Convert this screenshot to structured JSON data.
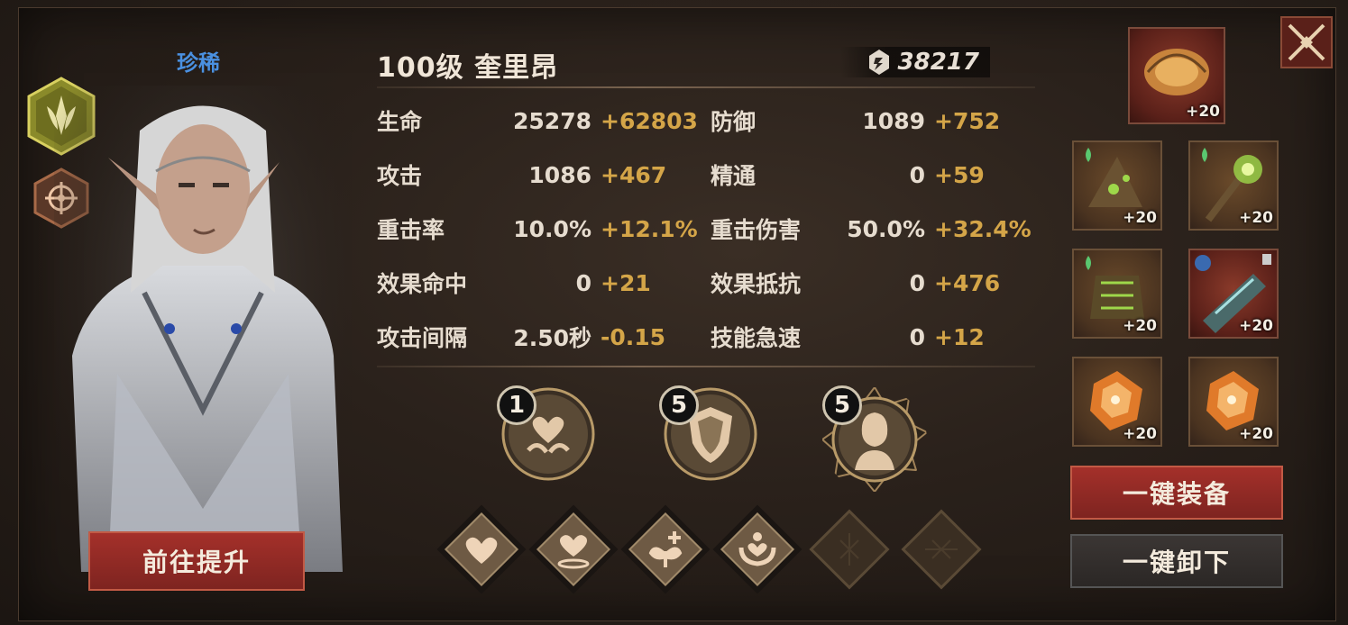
{
  "hero": {
    "rarity": "珍稀",
    "title": "100级  奎里昂",
    "power": "38217"
  },
  "stats": [
    {
      "label": "生命",
      "base": "25278",
      "bonus": "+62803"
    },
    {
      "label": "防御",
      "base": "1089",
      "bonus": "+752"
    },
    {
      "label": "攻击",
      "base": "1086",
      "bonus": "+467"
    },
    {
      "label": "精通",
      "base": "0",
      "bonus": "+59"
    },
    {
      "label": "重击率",
      "base": "10.0%",
      "bonus": "+12.1%"
    },
    {
      "label": "重击伤害",
      "base": "50.0%",
      "bonus": "+32.4%"
    },
    {
      "label": "效果命中",
      "base": "0",
      "bonus": "+21"
    },
    {
      "label": "效果抵抗",
      "base": "0",
      "bonus": "+476"
    },
    {
      "label": "攻击间隔",
      "base": "2.50秒",
      "bonus": "-0.15"
    },
    {
      "label": "技能急速",
      "base": "0",
      "bonus": "+12"
    }
  ],
  "skills": [
    {
      "level": "1",
      "icon": "heart-hands-icon"
    },
    {
      "level": "5",
      "icon": "shield-icon"
    },
    {
      "level": "5",
      "icon": "elf-portrait-icon"
    }
  ],
  "talents": [
    {
      "icon": "heart-icon",
      "active": true
    },
    {
      "icon": "heart-ripple-icon",
      "active": true
    },
    {
      "icon": "leaf-plus-icon",
      "active": true
    },
    {
      "icon": "hands-heart-icon",
      "active": true
    },
    {
      "icon": "locked-rune-icon",
      "active": false
    },
    {
      "icon": "locked-rune-icon",
      "active": false
    }
  ],
  "equipment": [
    {
      "name": "amulet",
      "level": "+20"
    },
    {
      "name": "hat",
      "level": "+20"
    },
    {
      "name": "staff",
      "level": "+20"
    },
    {
      "name": "armor",
      "level": "+20"
    },
    {
      "name": "bracer",
      "level": "+20"
    },
    {
      "name": "gem-left",
      "level": "+20"
    },
    {
      "name": "gem-right",
      "level": "+20"
    }
  ],
  "buttons": {
    "upgrade": "前往提升",
    "equip_all": "一键装备",
    "unequip_all": "一键卸下"
  },
  "colors": {
    "accent_red": "#a4302a",
    "bonus_gold": "#d4a548",
    "rarity_blue": "#4a90e0"
  }
}
